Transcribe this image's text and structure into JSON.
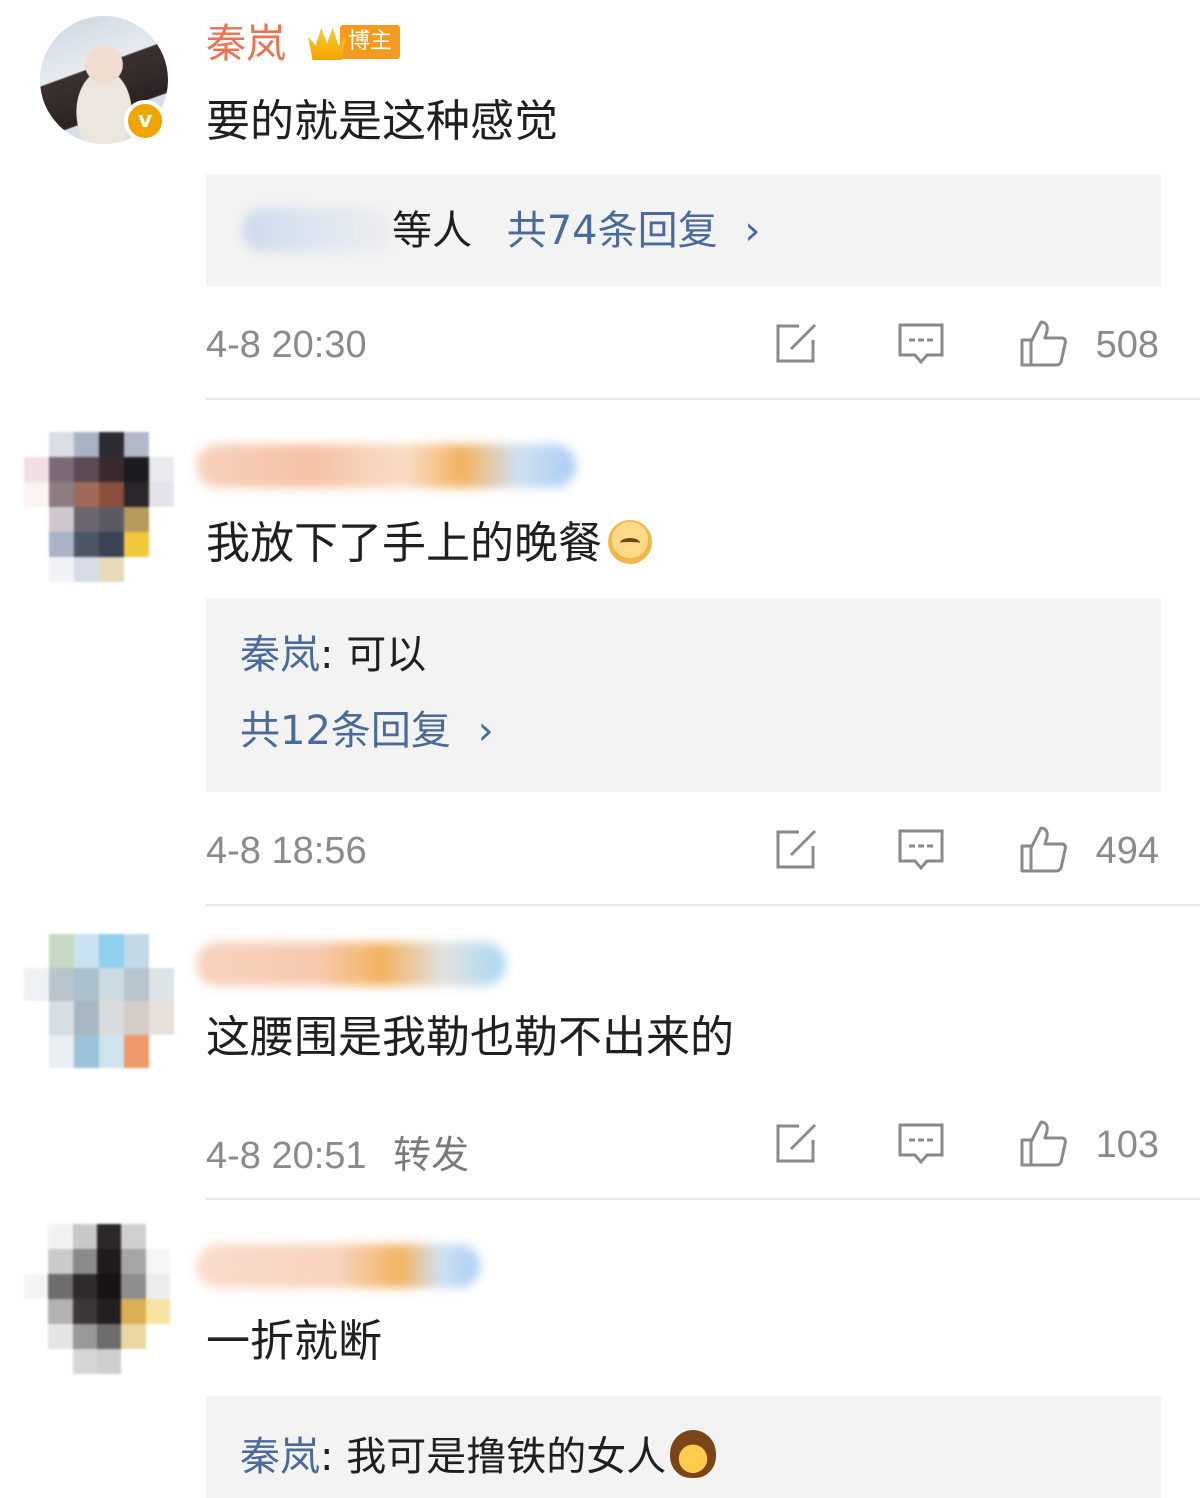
{
  "comments": [
    {
      "username": "秦岚",
      "badge_label": "博主",
      "text": "要的就是这种感觉",
      "reply_summary_suffix": "等人",
      "reply_link": "共74条回复",
      "time": "4-8 20:30",
      "likes": "508"
    },
    {
      "text": "我放下了手上的晚餐",
      "reply_author": "秦岚",
      "reply_text": ": 可以",
      "reply_link": "共12条回复",
      "time": "4-8 18:56",
      "likes": "494"
    },
    {
      "text": "这腰围是我勒也勒不出来的",
      "time": "4-8 20:51",
      "repost_label": "转发",
      "likes": "103"
    },
    {
      "text": "一折就断",
      "reply_author": "秦岚",
      "reply_text": ": 我可是撸铁的女人"
    }
  ],
  "icons": {
    "repost": "repost-icon",
    "comment": "comment-icon",
    "like": "thumbs-up-icon",
    "chevron": "chevron-right-icon"
  },
  "colors": {
    "username": "#eb7350",
    "link": "#4a6a9c",
    "meta": "#8a8a8a",
    "reply_bg": "#f3f3f3"
  }
}
